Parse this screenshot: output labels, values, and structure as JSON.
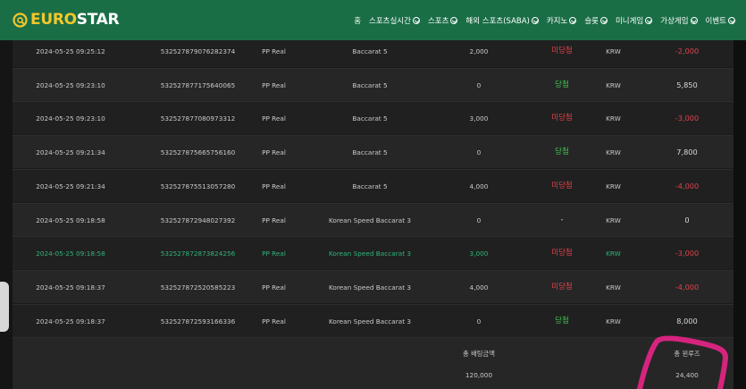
{
  "header": {
    "logo_part1": "EURO",
    "logo_part2": "STAR",
    "nav": [
      {
        "label": "홈",
        "dropdown": false
      },
      {
        "label": "스포츠실시간",
        "dropdown": true
      },
      {
        "label": "스포츠",
        "dropdown": true
      },
      {
        "label": "해외 스포츠(SABA)",
        "dropdown": true
      },
      {
        "label": "카지노",
        "dropdown": true
      },
      {
        "label": "슬롯",
        "dropdown": true
      },
      {
        "label": "미니게임",
        "dropdown": true
      },
      {
        "label": "가상게임",
        "dropdown": true
      },
      {
        "label": "이벤트",
        "dropdown": true
      }
    ]
  },
  "rows": [
    {
      "date": "2024-05-25 09:25:12",
      "id": "532527879076282374",
      "provider": "PP Real",
      "game": "Baccarat 5",
      "bet": "2,000",
      "result": "미당첨",
      "result_type": "lose",
      "currency": "KRW",
      "win": "-2,000",
      "win_type": "neg",
      "highlight": false
    },
    {
      "date": "2024-05-25 09:23:10",
      "id": "532527877175640065",
      "provider": "PP Real",
      "game": "Baccarat 5",
      "bet": "0",
      "result": "당첨",
      "result_type": "win",
      "currency": "KRW",
      "win": "5,850",
      "win_type": "pos",
      "highlight": false
    },
    {
      "date": "2024-05-25 09:23:10",
      "id": "532527877080973312",
      "provider": "PP Real",
      "game": "Baccarat 5",
      "bet": "3,000",
      "result": "미당첨",
      "result_type": "lose",
      "currency": "KRW",
      "win": "-3,000",
      "win_type": "neg",
      "highlight": false
    },
    {
      "date": "2024-05-25 09:21:34",
      "id": "532527875665756160",
      "provider": "PP Real",
      "game": "Baccarat 5",
      "bet": "0",
      "result": "당첨",
      "result_type": "win",
      "currency": "KRW",
      "win": "7,800",
      "win_type": "pos",
      "highlight": false
    },
    {
      "date": "2024-05-25 09:21:34",
      "id": "532527875513057280",
      "provider": "PP Real",
      "game": "Baccarat 5",
      "bet": "4,000",
      "result": "미당첨",
      "result_type": "lose",
      "currency": "KRW",
      "win": "-4,000",
      "win_type": "neg",
      "highlight": false
    },
    {
      "date": "2024-05-25 09:18:58",
      "id": "532527872948027392",
      "provider": "PP Real",
      "game": "Korean Speed Baccarat 3",
      "bet": "0",
      "result": "-",
      "result_type": "none",
      "currency": "KRW",
      "win": "0",
      "win_type": "pos",
      "highlight": false
    },
    {
      "date": "2024-05-25 09:18:58",
      "id": "532527872873824256",
      "provider": "PP Real",
      "game": "Korean Speed Baccarat 3",
      "bet": "3,000",
      "result": "미당첨",
      "result_type": "lose",
      "currency": "KRW",
      "win": "-3,000",
      "win_type": "neg",
      "highlight": true
    },
    {
      "date": "2024-05-25 09:18:37",
      "id": "532527872520585223",
      "provider": "PP Real",
      "game": "Korean Speed Baccarat 3",
      "bet": "4,000",
      "result": "미당첨",
      "result_type": "lose",
      "currency": "KRW",
      "win": "-4,000",
      "win_type": "neg",
      "highlight": false
    },
    {
      "date": "2024-05-25 09:18:37",
      "id": "532527872593166336",
      "provider": "PP Real",
      "game": "Korean Speed Baccarat 3",
      "bet": "0",
      "result": "당첨",
      "result_type": "win",
      "currency": "KRW",
      "win": "8,000",
      "win_type": "pos",
      "highlight": false
    }
  ],
  "summary": {
    "bet_label": "총 배팅금액",
    "bet_value": "120,000",
    "win_label": "총 윈루즈",
    "win_value": "24,400"
  },
  "colors": {
    "header_bg": "#1a6e46",
    "logo_gold": "#f2c72b",
    "lose": "#e0424a",
    "win": "#43c24f",
    "highlight_row": "#2fb47a",
    "annotation": "#d6247e"
  }
}
